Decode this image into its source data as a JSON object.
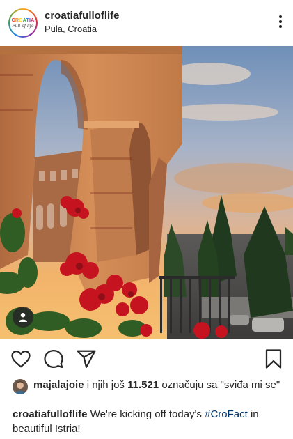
{
  "header": {
    "username": "croatiafulloflife",
    "location": "Pula, Croatia",
    "logo_top": [
      "C",
      "R",
      "O",
      "A",
      "T",
      "I",
      "A"
    ],
    "logo_bottom": "Full of life"
  },
  "likes": {
    "liker": "majalajoie",
    "connector": "i njih još",
    "count": "11.521",
    "suffix": "označuju sa \"sviđa mi se\""
  },
  "caption": {
    "username": "croatiafulloflife",
    "text_before": "We're kicking off today's",
    "hashtag": "#CroFact",
    "text_after": "in beautiful Istria!"
  },
  "icons": [
    "more-options-icon",
    "heart-icon",
    "comment-icon",
    "share-icon",
    "bookmark-icon",
    "user-tag-icon"
  ],
  "colors": {
    "text": "#262626",
    "hashtag": "#00376b",
    "background": "#ffffff"
  }
}
